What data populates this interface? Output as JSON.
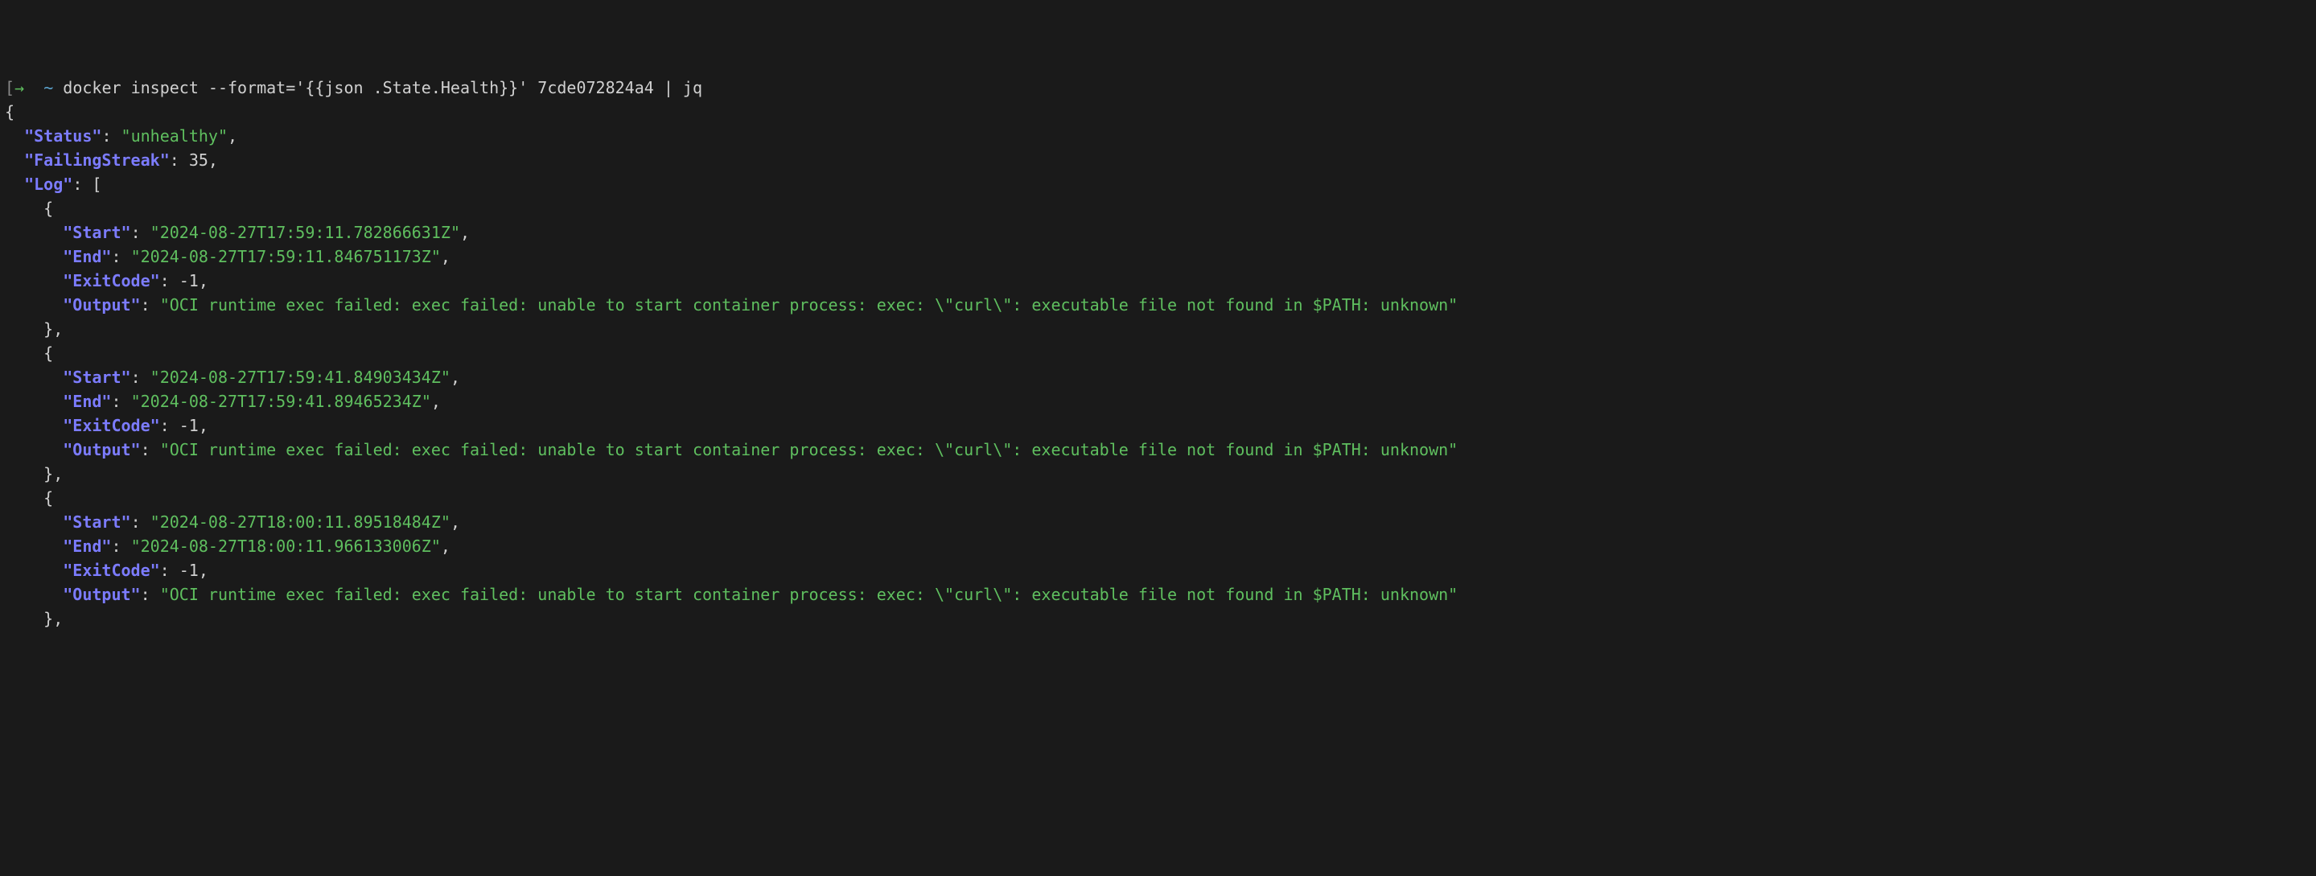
{
  "prompt": {
    "arrow": "→",
    "tilde": "~",
    "command": "docker inspect --format='{{json .State.Health}}' 7cde072824a4 | jq"
  },
  "json": {
    "Status": "unhealthy",
    "FailingStreak": 35,
    "Log": [
      {
        "Start": "2024-08-27T17:59:11.782866631Z",
        "End": "2024-08-27T17:59:11.846751173Z",
        "ExitCode": -1,
        "Output": "OCI runtime exec failed: exec failed: unable to start container process: exec: \\\"curl\\\": executable file not found in $PATH: unknown"
      },
      {
        "Start": "2024-08-27T17:59:41.84903434Z",
        "End": "2024-08-27T17:59:41.89465234Z",
        "ExitCode": -1,
        "Output": "OCI runtime exec failed: exec failed: unable to start container process: exec: \\\"curl\\\": executable file not found in $PATH: unknown"
      },
      {
        "Start": "2024-08-27T18:00:11.89518484Z",
        "End": "2024-08-27T18:00:11.966133006Z",
        "ExitCode": -1,
        "Output": "OCI runtime exec failed: exec failed: unable to start container process: exec: \\\"curl\\\": executable file not found in $PATH: unknown"
      }
    ]
  },
  "keys": {
    "Status": "Status",
    "FailingStreak": "FailingStreak",
    "Log": "Log",
    "Start": "Start",
    "End": "End",
    "ExitCode": "ExitCode",
    "Output": "Output"
  }
}
